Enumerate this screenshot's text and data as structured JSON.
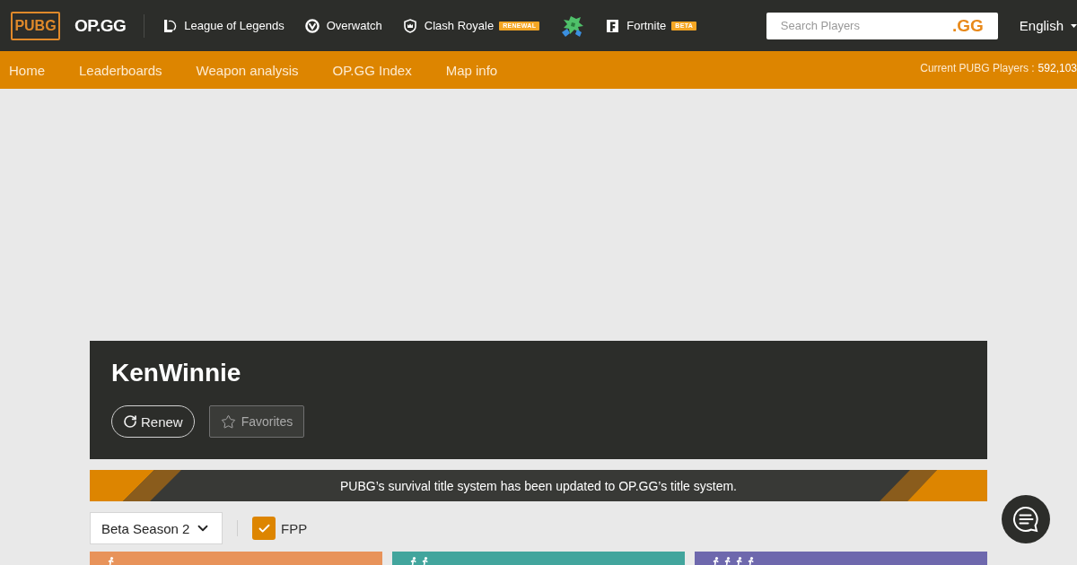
{
  "header": {
    "logo": "PUBG",
    "brand": "OP.GG",
    "games": [
      {
        "kind": "link",
        "label": "League of Legends"
      },
      {
        "kind": "link",
        "label": "Overwatch"
      },
      {
        "kind": "link",
        "label": "Clash Royale",
        "badge": "RENEWAL"
      },
      {
        "kind": "icon"
      },
      {
        "kind": "link",
        "label": "Fortnite",
        "badge": "BETA"
      }
    ],
    "search": {
      "placeholder": "Search Players",
      "button": ".GG"
    },
    "language": "English"
  },
  "nav": {
    "items": [
      "Home",
      "Leaderboards",
      "Weapon analysis",
      "OP.GG Index",
      "Map info"
    ],
    "player_count": {
      "label": "Current PUBG Players :",
      "value": "592,103"
    }
  },
  "profile": {
    "name": "KenWinnie",
    "buttons": [
      {
        "kind": "renew",
        "label": "Renew"
      },
      {
        "kind": "favorite",
        "label": "Favorites"
      }
    ]
  },
  "notice": "PUBG’s survival title system has been updated to OP.GG’s title system.",
  "filters": {
    "season": "Beta Season 2",
    "fpp": {
      "label": "FPP",
      "checked": true
    }
  },
  "modes": [
    {
      "kind": "solo",
      "color": "#e8935a"
    },
    {
      "kind": "duo",
      "color": "#42a59d"
    },
    {
      "kind": "squad",
      "color": "#6e68ad"
    }
  ]
}
